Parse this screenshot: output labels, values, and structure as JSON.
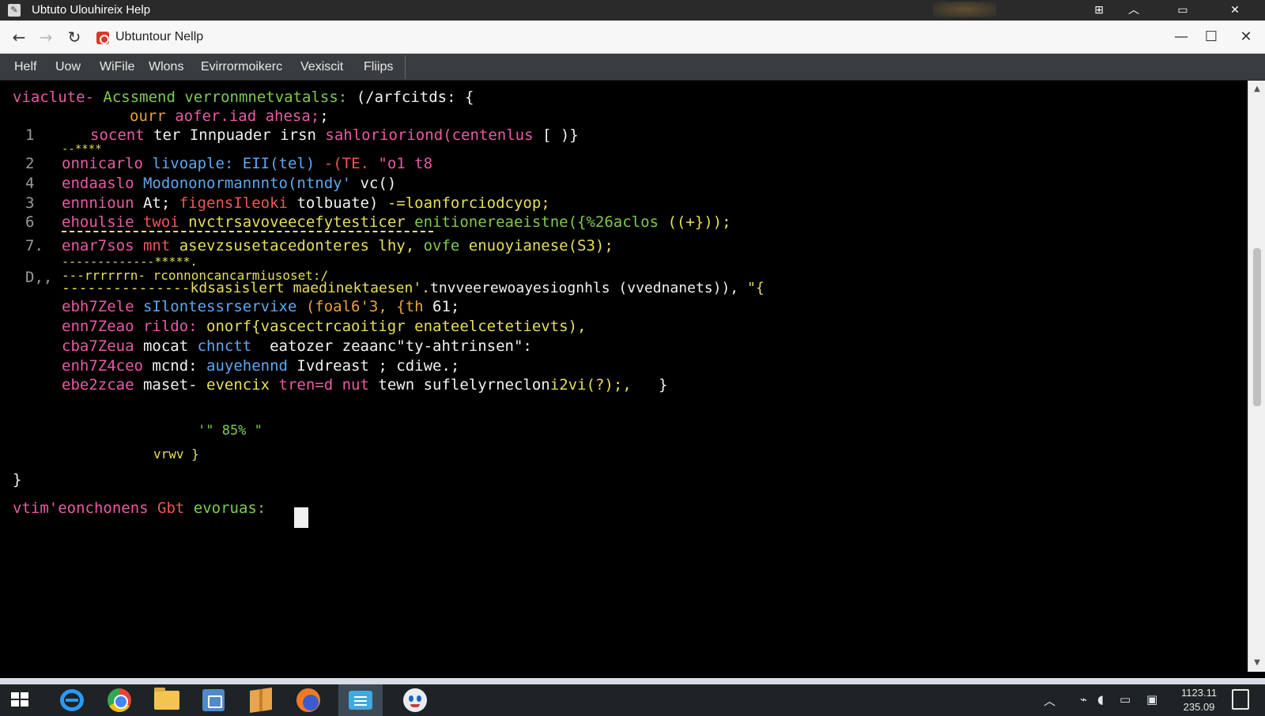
{
  "window": {
    "title": "Ubtuto Ulouhireix Help",
    "app_icon": "clipboard-icon",
    "controls": [
      "layout-icon",
      "chevron-up-icon",
      "minimize-icon",
      "close-icon"
    ]
  },
  "browser": {
    "tab_title": "Ubtuntour Nellp",
    "nav": [
      "back-arrow-icon",
      "forward-arrow-icon",
      "refresh-icon"
    ],
    "window_controls": [
      "minimize-icon",
      "maximize-icon",
      "close-icon"
    ],
    "accent_color": "#d83a2a"
  },
  "menu": {
    "items": [
      "Helf",
      "Uow",
      "WiFile",
      "Wlons",
      "Evirrormoikerc",
      "Vexiscit",
      "Fliips"
    ]
  },
  "terminal": {
    "line1": {
      "a": "viaclute-",
      "b": " Acssmend verronmnetvatalss:",
      "c": " (/arfcitds: {"
    },
    "line2": {
      "a": "ourr",
      "b": " aofer.iad ahesa;",
      "c": ";"
    },
    "rows": [
      {
        "num": "1",
        "parts": [
          "socent",
          " ter Innpuader irsn ",
          "sahlorioriond(centenlus",
          " [ )}"
        ]
      },
      {
        "num": "2",
        "parts": [
          "onnicarlo",
          " livoaple:",
          " EII(tel)",
          " ",
          "-(TE.",
          " \"o1 t8"
        ]
      },
      {
        "num": "4",
        "parts": [
          "endaaslo",
          " Modononormannnto",
          "(ntndy'",
          " vc()"
        ]
      },
      {
        "num": "3",
        "parts": [
          "ennnioun",
          " At;",
          " figensIleoki",
          " tolbuate)",
          " -=loanforciodcyop;"
        ]
      },
      {
        "num": "6",
        "parts": [
          "ehoulsie",
          " twoi",
          " nvctrsavoveecefytesticer",
          " enitionereaeistne(",
          "{%26aclos",
          " ((+}));"
        ]
      },
      {
        "num": "7.",
        "parts": [
          "enar7sos",
          " mnt",
          " asevzsusetacedonteres lhy,",
          " ovfe",
          " enuoyianese(S3);"
        ]
      },
      {
        "num": "D,,",
        "parts": [
          "---rrrrrrn-",
          " rconnoncancarmiusoset:/",
          "---------------kdsasislert",
          " maedinektaesen'.",
          "tnvveerewoayesiognhls (vvednanets)),",
          " \"{"
        ]
      }
    ],
    "tail_rows": [
      {
        "parts": [
          "ebh7Zele",
          " sIlontessrservixe",
          " (foal6'3,",
          " {th",
          " 61;"
        ]
      },
      {
        "parts": [
          "enn7Zeao",
          " rildo:",
          " onorf{vascectrcaoitigr enateelcetetievts),"
        ]
      },
      {
        "parts": [
          "cba7Zeua",
          " mocat",
          " chnctt",
          "  eatozer zeaanc\"ty-ahtrinsen\":"
        ]
      },
      {
        "parts": [
          "enh7Z4ceo",
          " mcnd:",
          " auyehennd",
          " Ivdreast ; cdiwe.;"
        ]
      },
      {
        "parts": [
          "ebe2zcae",
          " maset-",
          " evencix",
          " tren=d nut",
          " tewn",
          " suflelyrneclon",
          "i2vi(?);,",
          "   }"
        ]
      }
    ],
    "dashes": [
      "--****",
      "-------------*****."
    ],
    "progress": "'\" 85% \"",
    "closing_inner": "vrwv }",
    "closing_brace": "}",
    "prompt": {
      "a": "vtim'eonchonens",
      "b": " Gbt",
      "c": " evoruas:"
    },
    "colors": {
      "pink": "#e85aa5",
      "green": "#7ecb4e",
      "yellow": "#e7df5a",
      "blue": "#5ea8f0",
      "orange": "#e6a23b"
    }
  },
  "taskbar": {
    "apps": [
      "windows-start-icon",
      "edge-icon",
      "chrome-icon",
      "file-explorer-icon",
      "store-icon",
      "package-icon",
      "firefox-icon",
      "terminal-icon",
      "ubuntu-face-icon"
    ],
    "tray": [
      "chevron-up-icon",
      "network-icon",
      "volume-icon",
      "keyboard-icon",
      "battery-icon"
    ],
    "clock_time": "1123.11",
    "clock_date": "235.09"
  }
}
